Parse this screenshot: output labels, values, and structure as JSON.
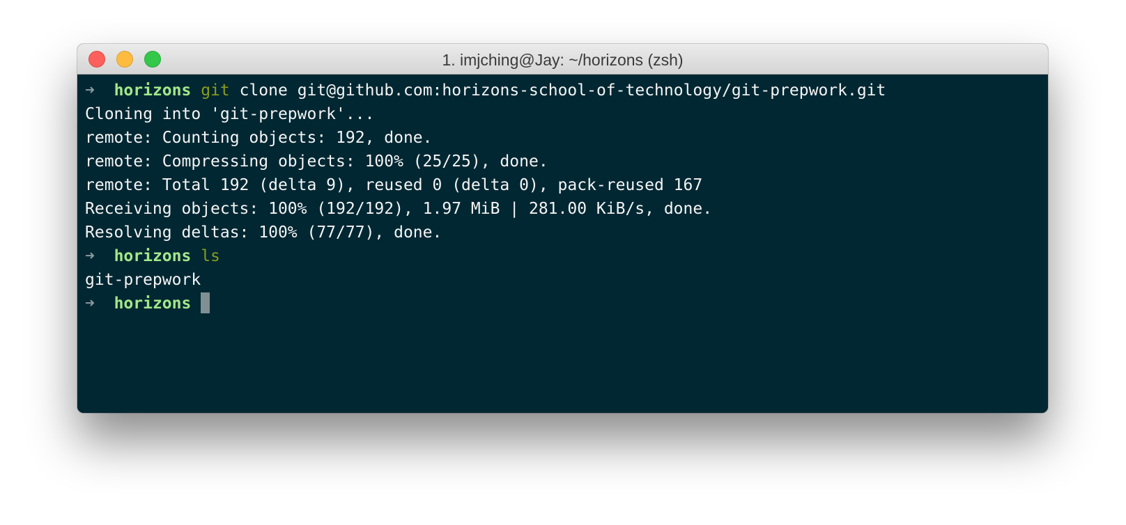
{
  "window": {
    "title": "1. imjching@Jay: ~/horizons (zsh)"
  },
  "colors": {
    "background": "#002732",
    "prompt_dir": "#a3e88a",
    "command": "#8a9c1c",
    "output": "#f4f4f4"
  },
  "terminal": {
    "prompt_symbol": "➜",
    "lines": [
      {
        "type": "prompt",
        "dir": "horizons",
        "cmd": "git",
        "args": "clone git@github.com:horizons-school-of-technology/git-prepwork.git"
      },
      {
        "type": "output",
        "text": "Cloning into 'git-prepwork'..."
      },
      {
        "type": "output",
        "text": "remote: Counting objects: 192, done."
      },
      {
        "type": "output",
        "text": "remote: Compressing objects: 100% (25/25), done."
      },
      {
        "type": "output",
        "text": "remote: Total 192 (delta 9), reused 0 (delta 0), pack-reused 167"
      },
      {
        "type": "output",
        "text": "Receiving objects: 100% (192/192), 1.97 MiB | 281.00 KiB/s, done."
      },
      {
        "type": "output",
        "text": "Resolving deltas: 100% (77/77), done."
      },
      {
        "type": "prompt",
        "dir": "horizons",
        "cmd": "ls",
        "args": ""
      },
      {
        "type": "output",
        "text": "git-prepwork"
      },
      {
        "type": "prompt",
        "dir": "horizons",
        "cmd": "",
        "args": "",
        "cursor": true
      }
    ]
  }
}
